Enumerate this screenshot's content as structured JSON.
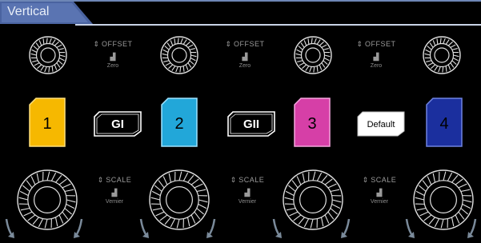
{
  "panel": {
    "title": "Vertical"
  },
  "channels": [
    {
      "id": "1",
      "label": "1",
      "color": "#f6b800"
    },
    {
      "id": "2",
      "label": "2",
      "color": "#22a7d9"
    },
    {
      "id": "3",
      "label": "3",
      "color": "#d63fa7"
    },
    {
      "id": "4",
      "label": "4",
      "color": "#1b2f9e"
    }
  ],
  "offset_controls": [
    {
      "label": "OFFSET",
      "sub": "Zero"
    },
    {
      "label": "OFFSET",
      "sub": "Zero"
    },
    {
      "label": "OFFSET",
      "sub": "Zero"
    }
  ],
  "scale_controls": [
    {
      "label": "SCALE",
      "sub": "Vernier"
    },
    {
      "label": "SCALE",
      "sub": "Vernier"
    },
    {
      "label": "SCALE",
      "sub": "Vernier"
    }
  ],
  "buttons": {
    "g1": "GI",
    "g2": "GII",
    "default": "Default"
  },
  "icons": {
    "knob": "knurled-knob-icon",
    "updown": "up-down-arrows-icon",
    "press": "press-button-icon",
    "rotate": "rotate-arrow-icon"
  }
}
